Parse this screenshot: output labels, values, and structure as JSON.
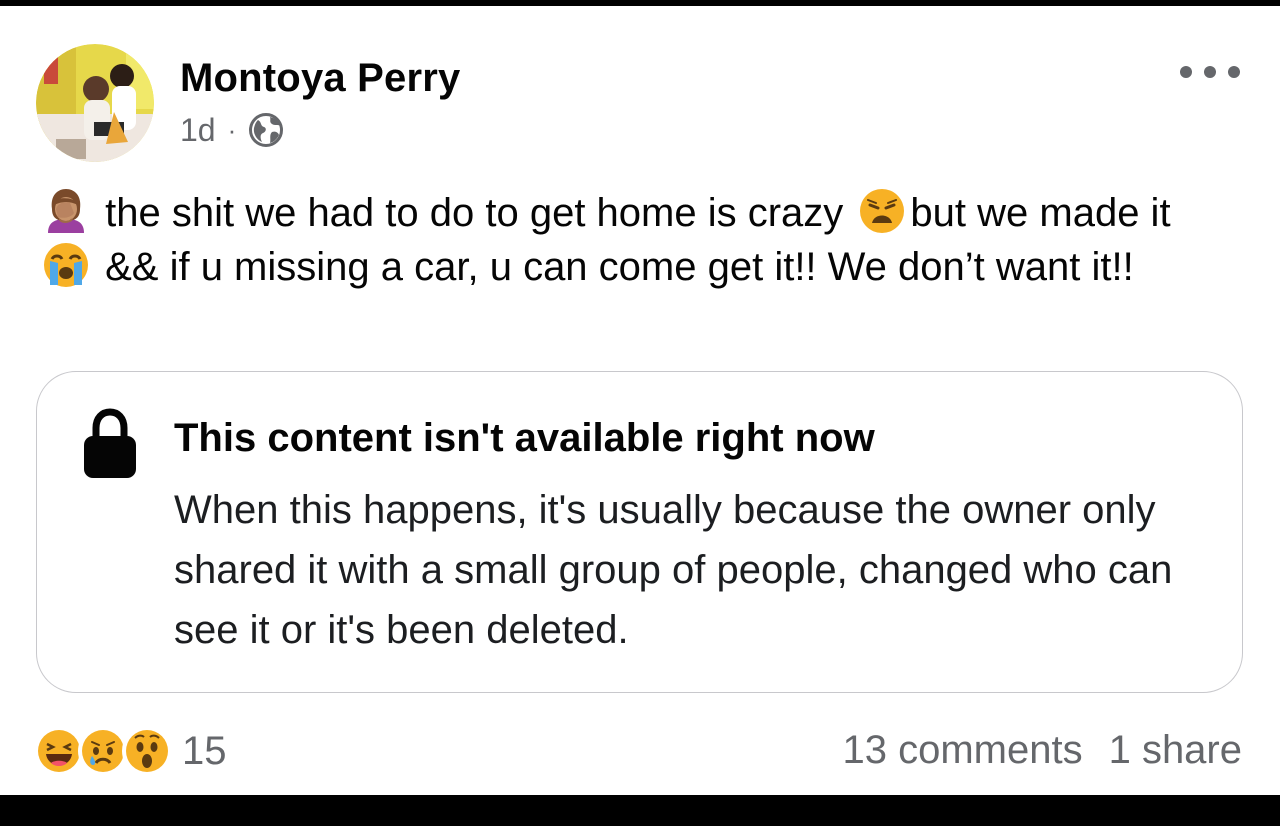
{
  "post": {
    "author": "Montoya Perry",
    "age": "1d",
    "separator": "·",
    "privacy_icon": "globe-icon",
    "more_icon": "more-options-icon",
    "text_segments": [
      {
        "type": "emoji",
        "name": "facepalm-woman-emoji"
      },
      {
        "type": "text",
        "value": " the shit we had to do to get home is crazy "
      },
      {
        "type": "emoji",
        "name": "weary-face-emoji"
      },
      {
        "type": "text",
        "value": "but we made it "
      },
      {
        "type": "emoji",
        "name": "crying-face-emoji"
      },
      {
        "type": "text",
        "value": " && if u missing a car, u can come get it!! We don’t want it!!"
      }
    ]
  },
  "unavailable": {
    "icon": "lock-icon",
    "title": "This content isn't available right now",
    "body": "When this happens, it's usually because the owner only shared it with a small group of people, changed who can see it or it's been deleted."
  },
  "footer": {
    "reactions": [
      "haha-reaction-icon",
      "sad-reaction-icon",
      "wow-reaction-icon"
    ],
    "reaction_count": "15",
    "comments": "13 comments",
    "shares": "1 share"
  },
  "colors": {
    "text_primary": "#050505",
    "text_secondary": "#65676b",
    "card_border": "#c8c8cc",
    "reaction_yellow": "#f7b125"
  }
}
